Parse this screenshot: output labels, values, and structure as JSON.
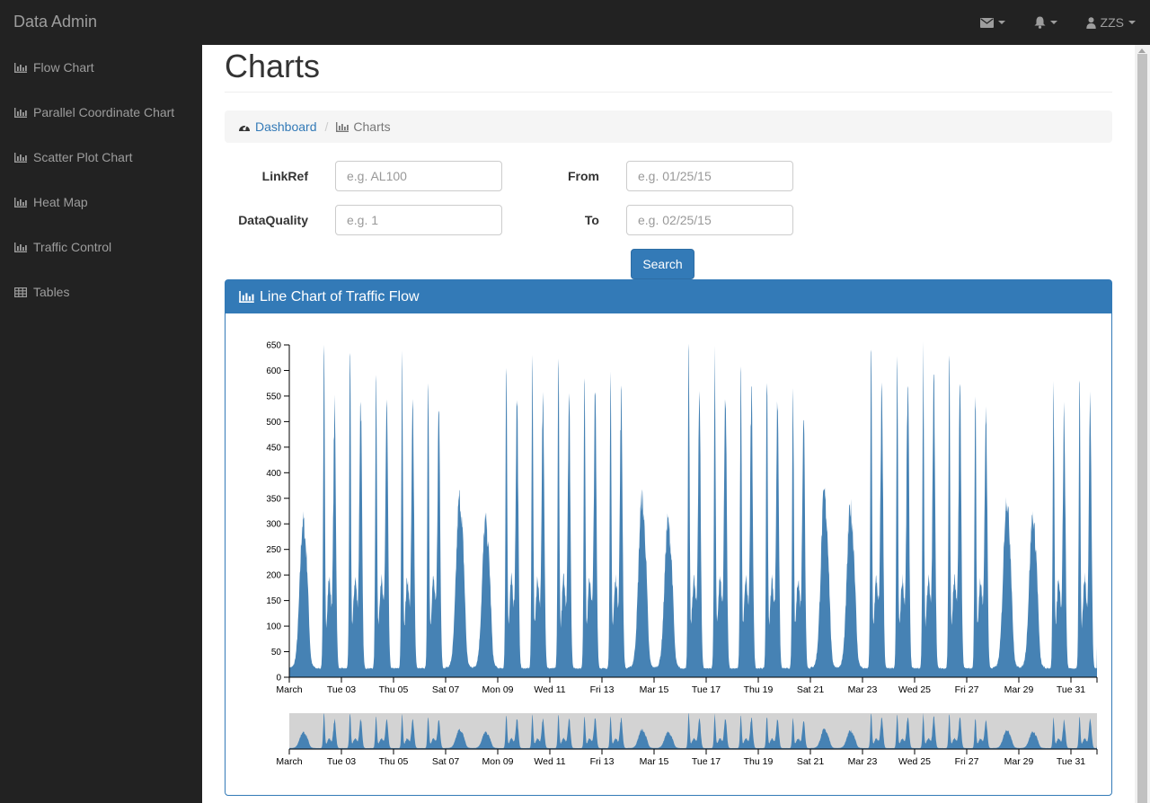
{
  "app": {
    "brand": "Data Admin"
  },
  "topnav": {
    "user": "ZZS",
    "icons": [
      "envelope-icon",
      "bell-icon",
      "user-icon"
    ]
  },
  "sidebar": {
    "items": [
      {
        "label": "Flow Chart",
        "icon": "bar-chart-icon"
      },
      {
        "label": "Parallel Coordinate Chart",
        "icon": "bar-chart-icon"
      },
      {
        "label": "Scatter Plot Chart",
        "icon": "bar-chart-icon"
      },
      {
        "label": "Heat Map",
        "icon": "bar-chart-icon"
      },
      {
        "label": "Traffic Control",
        "icon": "bar-chart-icon"
      },
      {
        "label": "Tables",
        "icon": "table-icon"
      }
    ]
  },
  "page": {
    "title": "Charts"
  },
  "breadcrumb": {
    "home": "Dashboard",
    "current": "Charts",
    "separator": "/"
  },
  "form": {
    "linkref_label": "LinkRef",
    "linkref_placeholder": "e.g. AL100",
    "dataquality_label": "DataQuality",
    "dataquality_placeholder": "e.g. 1",
    "from_label": "From",
    "from_placeholder": "e.g. 01/25/15",
    "to_label": "To",
    "to_placeholder": "e.g. 02/25/15",
    "search_label": "Search"
  },
  "panel": {
    "title": "Line Chart of Traffic Flow"
  },
  "colors": {
    "navbar": "#222222",
    "primary": "#337ab7",
    "area": "#4682b4",
    "context_bg": "#d3d3d3"
  },
  "chart_data": {
    "type": "area",
    "x_start": "2015-03-01",
    "x_end": "2015-04-01",
    "y_range": [
      0,
      650
    ],
    "y_ticks": [
      "0",
      "50",
      "100",
      "150",
      "200",
      "250",
      "300",
      "350",
      "400",
      "450",
      "500",
      "550",
      "600",
      "650"
    ],
    "x_ticks": [
      "March",
      "Tue 03",
      "Thu 05",
      "Sat 07",
      "Mon 09",
      "Wed 11",
      "Fri 13",
      "Mar 15",
      "Tue 17",
      "Thu 19",
      "Sat 21",
      "Mar 23",
      "Wed 25",
      "Fri 27",
      "Mar 29",
      "Tue 31"
    ],
    "x_tick_dates": [
      "2015-03-01",
      "2015-03-03",
      "2015-03-05",
      "2015-03-07",
      "2015-03-09",
      "2015-03-11",
      "2015-03-13",
      "2015-03-15",
      "2015-03-17",
      "2015-03-19",
      "2015-03-21",
      "2015-03-23",
      "2015-03-25",
      "2015-03-27",
      "2015-03-29",
      "2015-03-31"
    ],
    "daily_peaks": [
      {
        "date": "2015-03-01",
        "am": 340,
        "pm": 350
      },
      {
        "date": "2015-03-02",
        "am": 635,
        "pm": 570
      },
      {
        "date": "2015-03-03",
        "am": 635,
        "pm": 600
      },
      {
        "date": "2015-03-04",
        "am": 625,
        "pm": 580
      },
      {
        "date": "2015-03-05",
        "am": 625,
        "pm": 580
      },
      {
        "date": "2015-03-06",
        "am": 620,
        "pm": 580
      },
      {
        "date": "2015-03-07",
        "am": 390,
        "pm": 400
      },
      {
        "date": "2015-03-08",
        "am": 340,
        "pm": 355
      },
      {
        "date": "2015-03-09",
        "am": 640,
        "pm": 600
      },
      {
        "date": "2015-03-10",
        "am": 635,
        "pm": 600
      },
      {
        "date": "2015-03-11",
        "am": 625,
        "pm": 600
      },
      {
        "date": "2015-03-12",
        "am": 630,
        "pm": 600
      },
      {
        "date": "2015-03-13",
        "am": 570,
        "pm": 600
      },
      {
        "date": "2015-03-14",
        "am": 390,
        "pm": 380
      },
      {
        "date": "2015-03-15",
        "am": 340,
        "pm": 355
      },
      {
        "date": "2015-03-16",
        "am": 640,
        "pm": 605
      },
      {
        "date": "2015-03-17",
        "am": 625,
        "pm": 605
      },
      {
        "date": "2015-03-18",
        "am": 625,
        "pm": 600
      },
      {
        "date": "2015-03-19",
        "am": 625,
        "pm": 600
      },
      {
        "date": "2015-03-20",
        "am": 580,
        "pm": 575
      },
      {
        "date": "2015-03-21",
        "am": 400,
        "pm": 390
      },
      {
        "date": "2015-03-22",
        "am": 370,
        "pm": 360
      },
      {
        "date": "2015-03-23",
        "am": 650,
        "pm": 620
      },
      {
        "date": "2015-03-24",
        "am": 630,
        "pm": 620
      },
      {
        "date": "2015-03-25",
        "am": 625,
        "pm": 635
      },
      {
        "date": "2015-03-26",
        "am": 630,
        "pm": 620
      },
      {
        "date": "2015-03-27",
        "am": 575,
        "pm": 575
      },
      {
        "date": "2015-03-28",
        "am": 390,
        "pm": 370
      },
      {
        "date": "2015-03-29",
        "am": 350,
        "pm": 370
      },
      {
        "date": "2015-03-30",
        "am": 555,
        "pm": 560
      },
      {
        "date": "2015-03-31",
        "am": 585,
        "pm": 590
      }
    ]
  }
}
